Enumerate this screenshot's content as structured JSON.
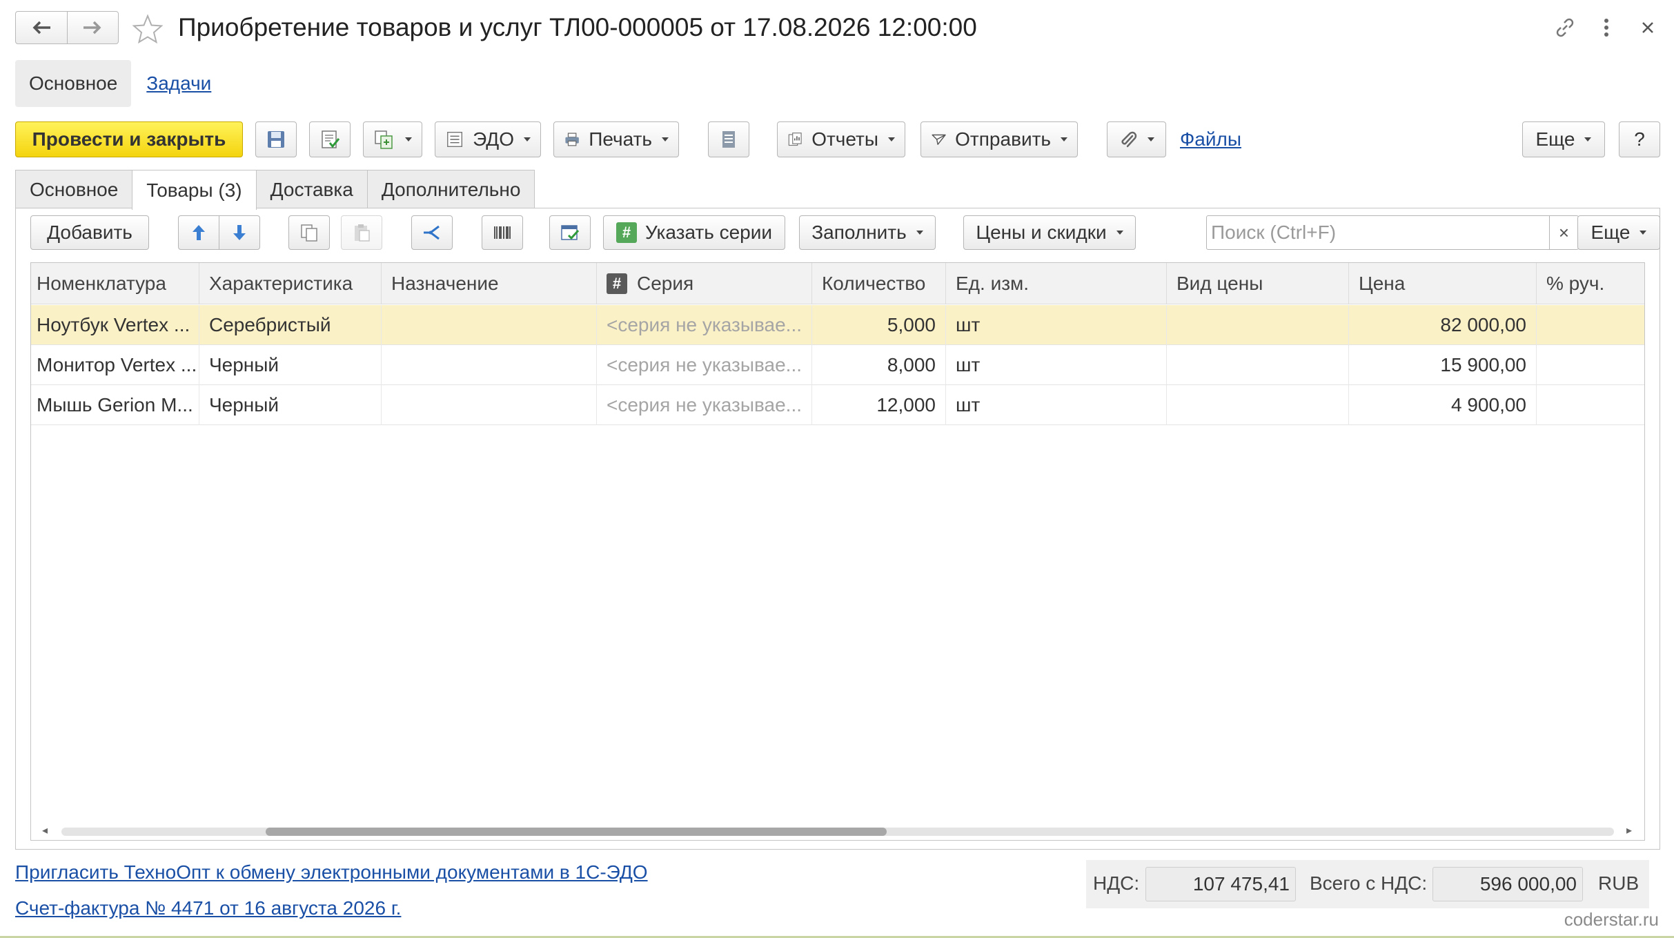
{
  "window": {
    "title": "Приобретение товаров и услуг ТЛ00-000005 от 17.08.2026 12:00:00",
    "icons": [
      "back-arrow-icon",
      "forward-arrow-icon",
      "star-icon",
      "link-icon",
      "more-vertical-icon",
      "close-icon"
    ]
  },
  "sections": {
    "active": "Основное",
    "link": "Задачи"
  },
  "toolbar": {
    "post_close": "Провести и закрыть",
    "edo": "ЭДО",
    "print": "Печать",
    "reports": "Отчеты",
    "send": "Отправить",
    "files": "Файлы",
    "more": "Еще",
    "help": "?"
  },
  "tabs": [
    {
      "label": "Основное",
      "active": false
    },
    {
      "label": "Товары (3)",
      "active": true
    },
    {
      "label": "Доставка",
      "active": false
    },
    {
      "label": "Дополнительно",
      "active": false
    }
  ],
  "table_toolbar": {
    "add": "Добавить",
    "set_series": "Указать серии",
    "fill": "Заполнить",
    "prices": "Цены и скидки",
    "search_placeholder": "Поиск (Ctrl+F)",
    "search_clear": "×",
    "more": "Еще"
  },
  "table": {
    "columns": [
      "Номенклатура",
      "Характеристика",
      "Назначение",
      "Серия",
      "Количество",
      "Ед. изм.",
      "Вид цены",
      "Цена",
      "% руч."
    ],
    "series_header_icon": "#",
    "rows": [
      {
        "name": "Ноутбук Vertex ...",
        "characteristic": "Серебристый",
        "purpose": "",
        "series": "<серия не указывае...",
        "quantity": "5,000",
        "unit": "шт",
        "price_type": "",
        "price": "82 000,00",
        "manual_pct": "",
        "selected": true
      },
      {
        "name": "Монитор Vertex ...",
        "characteristic": "Черный",
        "purpose": "",
        "series": "<серия не указывае...",
        "quantity": "8,000",
        "unit": "шт",
        "price_type": "",
        "price": "15 900,00",
        "manual_pct": "",
        "selected": false
      },
      {
        "name": "Мышь Gerion M...",
        "characteristic": "Черный",
        "purpose": "",
        "series": "<серия не указывае...",
        "quantity": "12,000",
        "unit": "шт",
        "price_type": "",
        "price": "4 900,00",
        "manual_pct": "",
        "selected": false
      }
    ]
  },
  "footer": {
    "invite_link": "Пригласить ТехноОпт к обмену электронными документами в 1С-ЭДО",
    "invoice_link": "Счет-фактура № 4471 от 16 августа 2026 г.",
    "vat_label": "НДС:",
    "vat_value": "107 475,41",
    "total_label": "Всего с НДС:",
    "total_value": "596 000,00",
    "currency": "RUB"
  },
  "watermark": "coderstar.ru",
  "colors": {
    "primary_button": "#f4d40e",
    "link": "#1a4fa6",
    "selected_row": "#fbf1c6"
  }
}
